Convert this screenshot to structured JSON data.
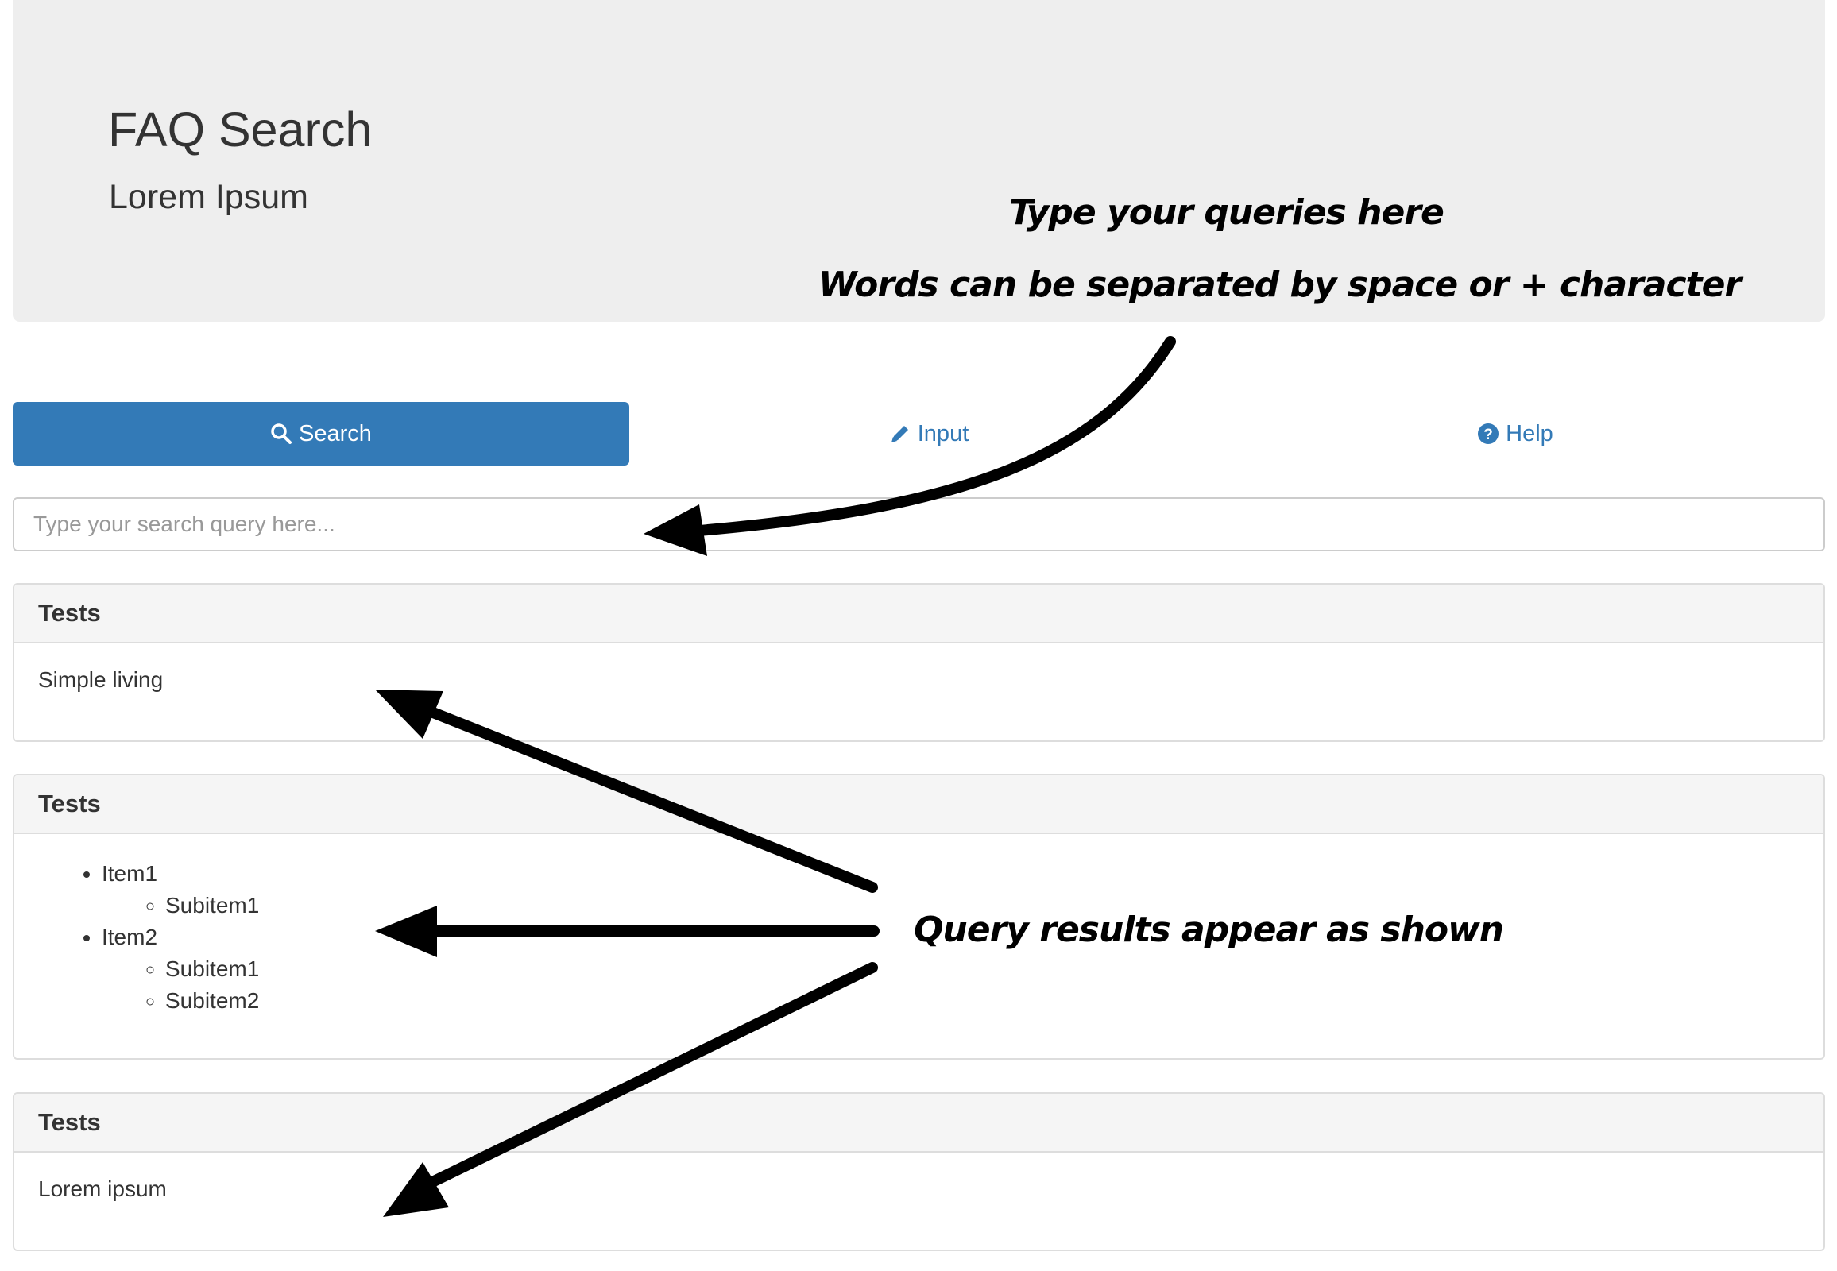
{
  "header": {
    "title": "FAQ Search",
    "subtitle": "Lorem Ipsum"
  },
  "nav": {
    "items": [
      {
        "label": "Search",
        "icon": "search-icon",
        "active": true
      },
      {
        "label": "Input",
        "icon": "pencil-icon",
        "active": false
      },
      {
        "label": "Help",
        "icon": "question-circle-icon",
        "active": false
      }
    ]
  },
  "search": {
    "placeholder": "Type your search query here...",
    "value": ""
  },
  "results": [
    {
      "heading": "Tests",
      "body": "Simple living"
    },
    {
      "heading": "Tests",
      "list": [
        {
          "label": "Item1",
          "subitems": [
            "Subitem1"
          ]
        },
        {
          "label": "Item2",
          "subitems": [
            "Subitem1",
            "Subitem2"
          ]
        }
      ]
    },
    {
      "heading": "Tests",
      "body": "Lorem ipsum"
    }
  ],
  "annotations": {
    "query_hint": "Type your queries here",
    "separator_hint": "Words can be separated by space or + character",
    "results_hint": "Query results appear as shown"
  },
  "colors": {
    "primary": "#337ab7",
    "jumbotron_bg": "#eeeeee",
    "panel_heading_bg": "#f5f5f5",
    "border": "#dddddd"
  }
}
